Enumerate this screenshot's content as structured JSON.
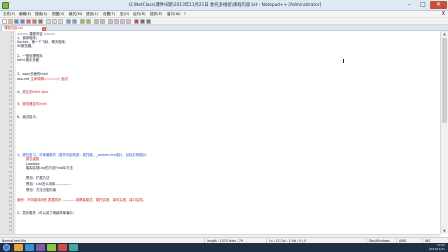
{
  "window": {
    "title": "G:\\NetClass\\课件\\6期\\2013年11月21日 委托多线程\\课程内容.txt - Notepad++ [Administrator]",
    "minimize_glyph": "–",
    "maximize_glyph": "□",
    "close_glyph": "✕"
  },
  "menu": {
    "items": [
      "文件(F)",
      "编辑(E)",
      "搜索(S)",
      "视图(V)",
      "格式(M)",
      "语言(L)",
      "设置(T)",
      "宏(O)",
      "运行(R)",
      "插件(P)",
      "窗口(W)",
      "?"
    ],
    "close_glyph": "X"
  },
  "tab": {
    "label": "课程内容.txt",
    "close_glyph": "x"
  },
  "editor": {
    "line_numbers": [
      "1",
      "2",
      "3",
      "4",
      "5",
      "6",
      "7",
      "8",
      "9",
      "10",
      "11",
      "12",
      "13",
      "14",
      "15",
      "16",
      "17",
      "18",
      "19",
      "20",
      "21",
      "22",
      "23",
      "24",
      "25",
      "26",
      "27",
      "28",
      "29",
      "30",
      "31",
      "32",
      "33",
      "34",
      "35",
      "36",
      "37",
      "38",
      "39",
      "40",
      "41",
      "42",
      "43",
      "44",
      "45",
      "46",
      "47",
      "48"
    ],
    "lines": {
      "l1": "==== 课程内容 ====",
      "l2a": "1、",
      "l2b": "窗体程序。",
      "l3": "Socket，第一个飞秋，聊天程序。",
      "l4": "IIS服务器。",
      "l5": "2、一般处理程序",
      "l6": "html 展示页面",
      "l7": "3、aspx页面的html",
      "l8a": "asp.net ",
      "l8b": "生命周期=====》面试",
      "l9a": "4、",
      "l9b": "原生的html Ajax",
      "l10a": "5、",
      "l10b": "服务器控件html",
      "l11": "6、面试讲义。",
      "l12a": "1、",
      "l12b": "委托复习，可单播委托（委托内部构造：委托链，_prebervice指针，目标实例指针）",
      "l13": "匿名函数",
      "l14": "Lambda",
      "l15": "模拟实现List的方法FindAll方法",
      "l16": "冒泡：扩展方法",
      "l17": "冒泡：List怎么排序-------------",
      "l18": "冒泡：方法泛型约束",
      "l19a": "案例：",
      "l19b": "不同窗体间的 数据同步",
      "l19c": " ---------- ",
      "l19d": "观察者模式、委托实现、事件实现、接口实现。",
      "l20": "2、异步委托（可以讲了继续简单演示）"
    }
  },
  "status": {
    "file_type": "Normal text file",
    "length": "length : 1574    lines : 79",
    "position": "Ln : 12    Col : 1    Sel : 0 | 0",
    "eol": "Dos\\Windows",
    "encoding": "ANSI",
    "mode": "INS"
  },
  "taskbar": {
    "time": "12:02",
    "date": "2013/11/21"
  },
  "colors": {
    "accent_red": "#c4232b",
    "accent_blue": "#2457c5",
    "close_button": "#c7503c",
    "taskbar": "#1f3045"
  }
}
